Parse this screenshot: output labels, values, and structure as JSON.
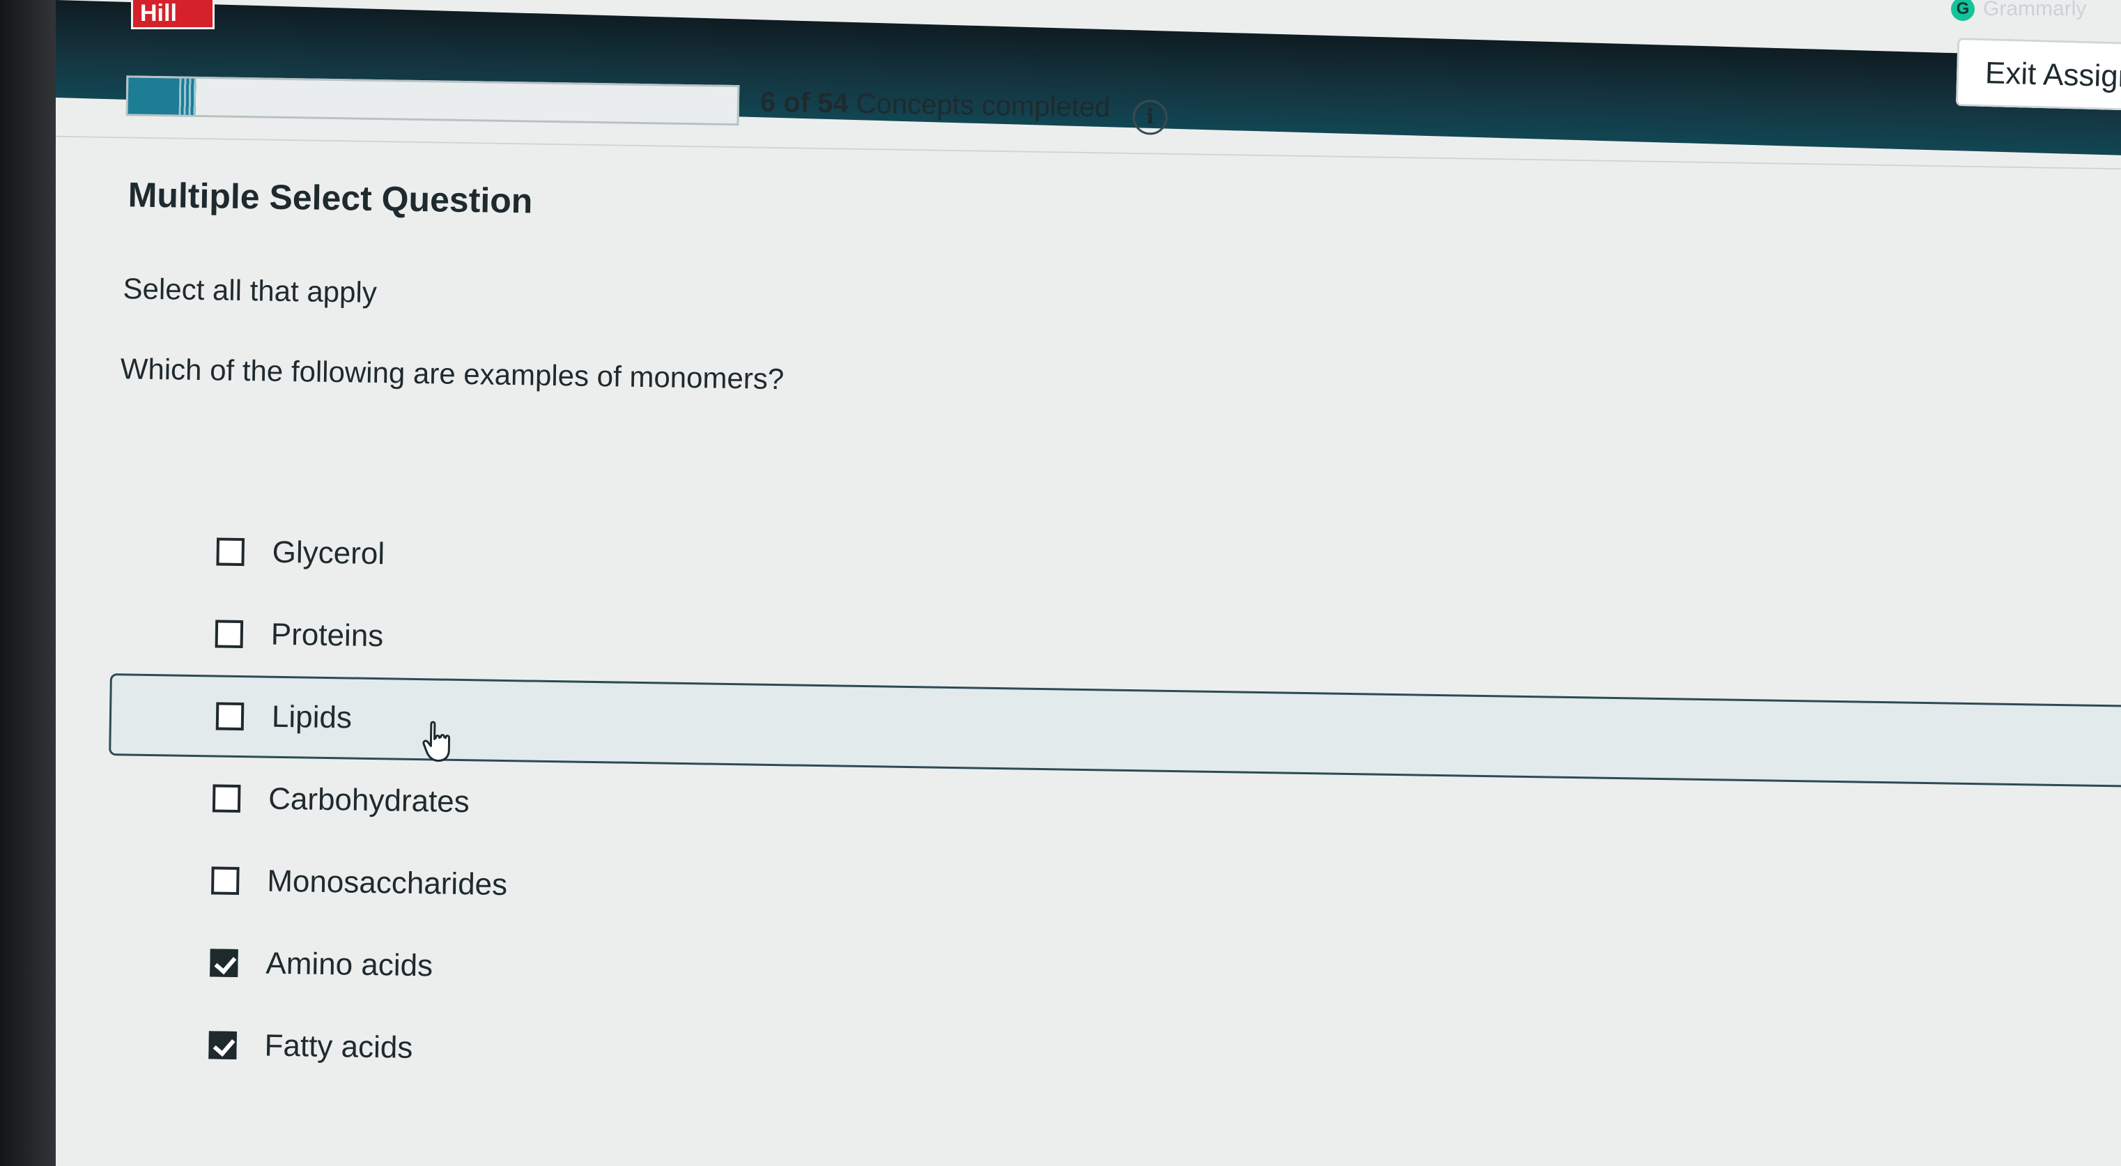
{
  "header": {
    "brand": "Hill",
    "grammarly_label": "Grammarly",
    "exit_button_label": "Exit Assign"
  },
  "progress": {
    "completed": 6,
    "total": 54,
    "count_text": "6 of 54",
    "label": "Concepts completed",
    "fraction": 0.111
  },
  "question": {
    "type_title": "Multiple Select Question",
    "instruction": "Select all that apply",
    "prompt": "Which of the following are examples of monomers?"
  },
  "options": [
    {
      "label": "Glycerol",
      "checked": false
    },
    {
      "label": "Proteins",
      "checked": false
    },
    {
      "label": "Lipids",
      "checked": false
    },
    {
      "label": "Carbohydrates",
      "checked": false
    },
    {
      "label": "Monosaccharides",
      "checked": false
    },
    {
      "label": "Amino acids",
      "checked": true
    },
    {
      "label": "Fatty acids",
      "checked": true
    }
  ],
  "hovered_option_index": 2,
  "colors": {
    "header_bg": "#124653",
    "progress_fill": "#1c7d95",
    "brand_red": "#d4212a",
    "text": "#1f2a2e"
  }
}
